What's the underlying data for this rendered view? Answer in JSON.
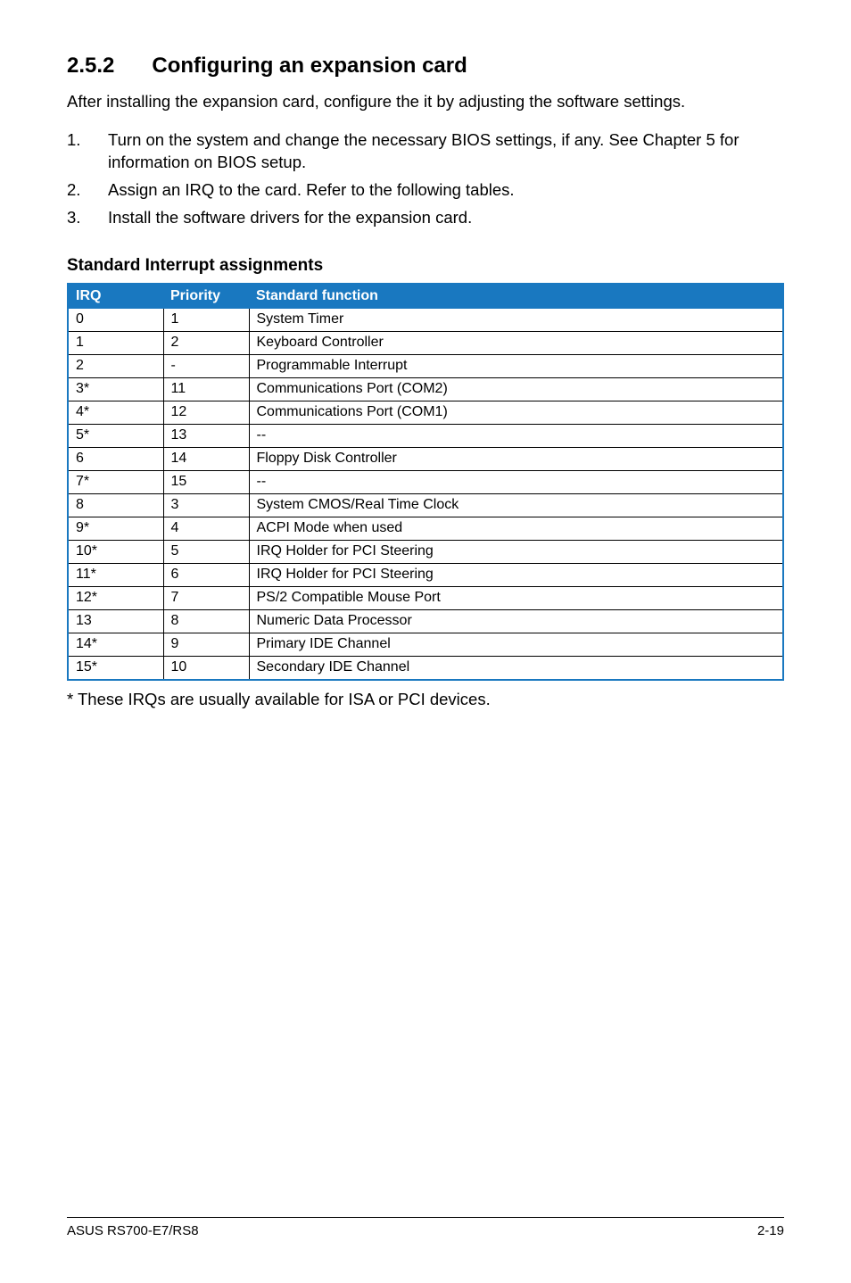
{
  "heading": {
    "number": "2.5.2",
    "title": "Configuring an expansion card"
  },
  "intro": "After installing the expansion card, configure the it by adjusting the software settings.",
  "steps": [
    {
      "num": "1.",
      "text": "Turn on the system and change the necessary BIOS settings, if any. See Chapter 5 for information on BIOS setup."
    },
    {
      "num": "2.",
      "text": "Assign an IRQ to the card. Refer to the following tables."
    },
    {
      "num": "3.",
      "text": "Install the software drivers for the expansion card."
    }
  ],
  "subheading": "Standard Interrupt assignments",
  "table": {
    "headers": {
      "irq": "IRQ",
      "priority": "Priority",
      "func": "Standard function"
    },
    "rows": [
      {
        "irq": "0",
        "priority": "1",
        "func": "System Timer"
      },
      {
        "irq": "1",
        "priority": "2",
        "func": "Keyboard Controller"
      },
      {
        "irq": "2",
        "priority": "-",
        "func": "Programmable Interrupt"
      },
      {
        "irq": "3*",
        "priority": "11",
        "func": "Communications Port (COM2)"
      },
      {
        "irq": "4*",
        "priority": "12",
        "func": "Communications Port (COM1)"
      },
      {
        "irq": "5*",
        "priority": "13",
        "func": "--"
      },
      {
        "irq": "6",
        "priority": "14",
        "func": "Floppy Disk Controller"
      },
      {
        "irq": "7*",
        "priority": "15",
        "func": "--"
      },
      {
        "irq": "8",
        "priority": "3",
        "func": "System CMOS/Real Time Clock"
      },
      {
        "irq": "9*",
        "priority": "4",
        "func": "ACPI Mode when used"
      },
      {
        "irq": "10*",
        "priority": "5",
        "func": "IRQ Holder for PCI Steering"
      },
      {
        "irq": "11*",
        "priority": "6",
        "func": "IRQ Holder for PCI Steering"
      },
      {
        "irq": "12*",
        "priority": "7",
        "func": "PS/2 Compatible Mouse Port"
      },
      {
        "irq": "13",
        "priority": "8",
        "func": "Numeric Data Processor"
      },
      {
        "irq": "14*",
        "priority": "9",
        "func": "Primary IDE Channel"
      },
      {
        "irq": "15*",
        "priority": "10",
        "func": "Secondary IDE Channel"
      }
    ]
  },
  "footnote": "* These IRQs are usually available for ISA or PCI devices.",
  "footer": {
    "left": "ASUS RS700-E7/RS8",
    "right": "2-19"
  }
}
